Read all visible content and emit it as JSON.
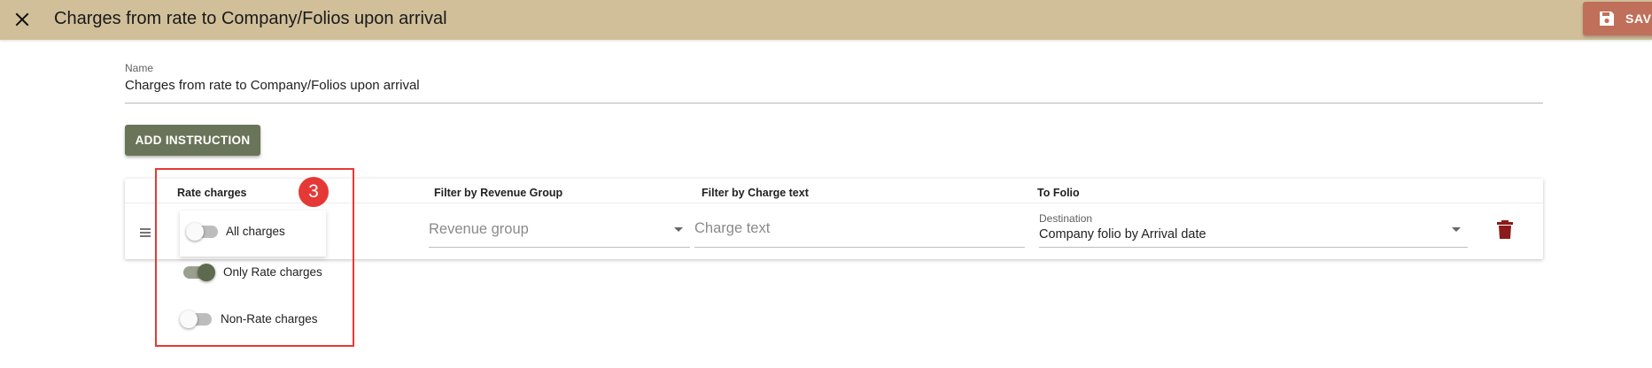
{
  "header": {
    "title": "Charges from rate to Company/Folios upon arrival",
    "close_icon": "close-icon",
    "save_label": "SAV",
    "save_icon": "floppy-disk-icon",
    "background": "#d1bf9a"
  },
  "name_field": {
    "label": "Name",
    "value": "Charges from rate to Company/Folios upon arrival"
  },
  "add_instruction": {
    "label": "ADD INSTRUCTION",
    "color": "#6a7458"
  },
  "table": {
    "headers": {
      "rate_charges": "Rate charges",
      "revenue_group": "Filter by Revenue Group",
      "charge_text": "Filter by Charge text",
      "to_folio": "To Folio"
    },
    "row": {
      "revenue_group_placeholder": "Revenue group",
      "charge_text_placeholder": "Charge text",
      "destination_label": "Destination",
      "destination_value": "Company folio by Arrival date",
      "delete_icon": "trash-icon",
      "delete_color": "#8b1a1a"
    }
  },
  "rate_charge_options": [
    {
      "label": "All charges",
      "checked": false
    },
    {
      "label": "Only Rate charges",
      "checked": true
    },
    {
      "label": "Non-Rate charges",
      "checked": false
    }
  ],
  "annotation": {
    "step": "3",
    "color": "#e53935"
  }
}
